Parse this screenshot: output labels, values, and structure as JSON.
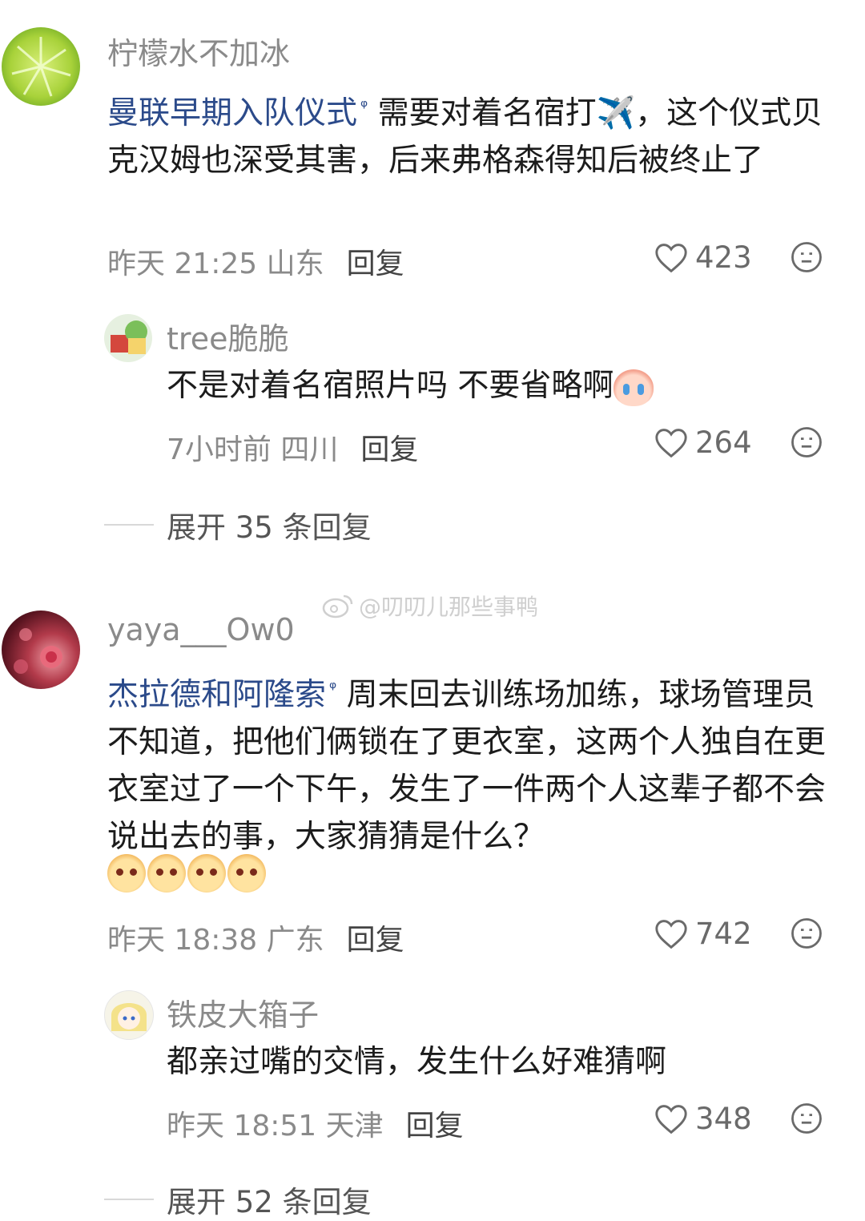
{
  "comments": [
    {
      "username": "柠檬水不加冰",
      "topic": "曼联早期入队仪式",
      "text": "需要对着名宿打✈️，这个仪式贝克汉姆也深受其害，后来弗格森得知后被终止了",
      "time": "昨天 21:25 山东",
      "reply": "回复",
      "likes": "423"
    },
    {
      "username": "tree脆脆",
      "text": "不是对着名宿照片吗 不要省略啊",
      "time": "7小时前 四川",
      "reply": "回复",
      "likes": "264"
    },
    {
      "expand": "展开 35 条回复"
    },
    {
      "username": "yaya___Ow0",
      "topic": "杰拉德和阿隆索",
      "text": "周末回去训练场加练，球场管理员不知道，把他们俩锁在了更衣室，这两个人独自在更衣室过了一个下午，发生了一件两个人这辈子都不会说出去的事，大家猜猜是什么？",
      "time": "昨天 18:38 广东",
      "reply": "回复",
      "likes": "742"
    },
    {
      "username": "铁皮大箱子",
      "text": "都亲过嘴的交情，发生什么好难猜啊",
      "time": "昨天 18:51 天津",
      "reply": "回复",
      "likes": "348"
    },
    {
      "expand": "展开 52 条回复"
    }
  ],
  "watermark": "@叨叨儿那些事鸭"
}
